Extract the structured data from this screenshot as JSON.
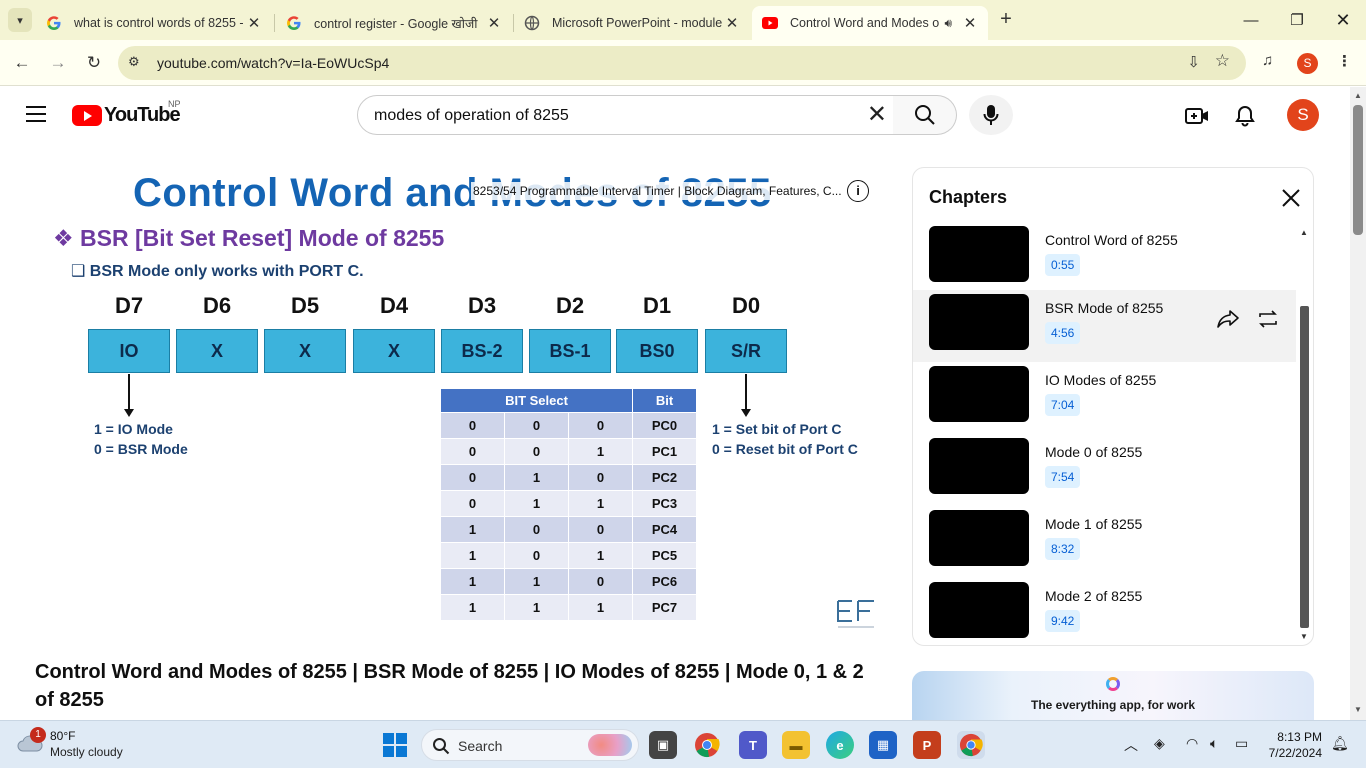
{
  "browser": {
    "tabs": [
      {
        "title": "what is control words of 8255 -",
        "icon": "google-icon",
        "active": false
      },
      {
        "title": "control register - Google खोजी",
        "icon": "google-icon",
        "active": false
      },
      {
        "title": "Microsoft PowerPoint - module",
        "icon": "web-icon",
        "active": false
      },
      {
        "title": "Control Word and Modes o",
        "icon": "youtube-icon",
        "active": true
      }
    ],
    "url": "youtube.com/watch?v=Ia-EoWUcSp4",
    "profile_initial": "S"
  },
  "youtube": {
    "logo_text": "YouTube",
    "country_code": "NP",
    "search_value": "modes of operation of 8255",
    "avatar_initial": "S"
  },
  "video": {
    "slide_title": "Control Word and Modes of 8255",
    "overlay_title": "8253/54 Programmable Interval Timer | Block Diagram, Features, C...",
    "bsr_heading": "❖ BSR [Bit Set Reset] Mode of 8255",
    "bsr_sub": "❑ BSR Mode only works with PORT C.",
    "bit_labels": [
      "D7",
      "D6",
      "D5",
      "D4",
      "D3",
      "D2",
      "D1",
      "D0"
    ],
    "bit_boxes": [
      "IO",
      "X",
      "X",
      "X",
      "BS-2",
      "BS-1",
      "BS0",
      "S/R"
    ],
    "note_left_1": "1 = IO Mode",
    "note_left_2": "0 = BSR Mode",
    "note_right_1": "1 = Set bit of Port C",
    "note_right_2": "0 = Reset bit of Port C",
    "table_header_select": "BIT Select",
    "table_header_bit": "Bit",
    "table_rows": [
      [
        "0",
        "0",
        "0",
        "PC0"
      ],
      [
        "0",
        "0",
        "1",
        "PC1"
      ],
      [
        "0",
        "1",
        "0",
        "PC2"
      ],
      [
        "0",
        "1",
        "1",
        "PC3"
      ],
      [
        "1",
        "0",
        "0",
        "PC4"
      ],
      [
        "1",
        "0",
        "1",
        "PC5"
      ],
      [
        "1",
        "1",
        "0",
        "PC6"
      ],
      [
        "1",
        "1",
        "1",
        "PC7"
      ]
    ],
    "title": "Control Word and Modes of 8255 | BSR Mode of 8255 | IO Modes of 8255 | Mode 0, 1 & 2 of 8255"
  },
  "chapters": {
    "heading": "Chapters",
    "items": [
      {
        "title": "Control Word of 8255",
        "time": "0:55"
      },
      {
        "title": "BSR Mode of 8255",
        "time": "4:56"
      },
      {
        "title": "IO Modes of 8255",
        "time": "7:04"
      },
      {
        "title": "Mode 0 of 8255",
        "time": "7:54"
      },
      {
        "title": "Mode 1 of 8255",
        "time": "8:32"
      },
      {
        "title": "Mode 2 of 8255",
        "time": "9:42"
      }
    ]
  },
  "ad": {
    "text": "The everything app, for work"
  },
  "taskbar": {
    "weather_badge": "1",
    "temperature": "80°F",
    "condition": "Mostly cloudy",
    "search_label": "Search",
    "time": "8:13 PM",
    "date": "7/22/2024"
  },
  "colors": {
    "youtube_red": "#ff0000",
    "slide_title_blue": "#1464b4",
    "bit_box_blue": "#3cb3dc",
    "bsr_purple": "#6e3aa0",
    "table_header": "#4472c4",
    "chapter_time": "#065fd4"
  }
}
